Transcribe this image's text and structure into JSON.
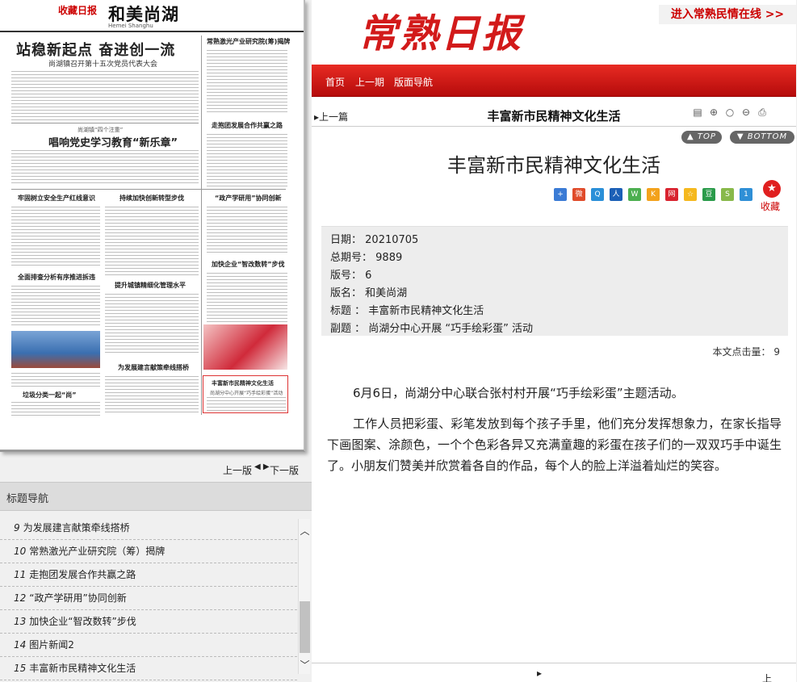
{
  "paper_preview": {
    "logo_text": "收藏日报",
    "page_name": "和美尚湖",
    "page_pinyin": "Hemei Shanghu",
    "headline": "站稳新起点 奋进创一流",
    "headline_sub": "尚湖镇召开第十五次党员代表大会",
    "kicker": "尚湖镇“四个注重”",
    "h_party": "唱响党史学习教育“新乐章”",
    "h_laser": "常熟激光产业研究院(筹)揭牌",
    "h_group": "走抱团发展合作共赢之路",
    "h_safety": "牢固树立安全生产红线意识",
    "h_transform": "持续加快创新转型步伐",
    "h_zcx": "“政产学研用”协同创新",
    "h_env": "全面排查分析有序推进拆违",
    "h_digital": "加快企业“智改数转”步伐",
    "h_urban": "提升城镇精细化管理水平",
    "h_bridge": "为发展建言献策牵线搭桥",
    "h_garbage": "垃圾分类一起“尚”",
    "h_culture": "丰富新市民精神文化生活",
    "h_culture_sub": "尚湖分中心开展“巧手绘彩蛋”活动"
  },
  "pager": {
    "prev": "上一版",
    "arrows": "◀ ▶",
    "next": "下一版"
  },
  "title_nav": {
    "header": "标题导航",
    "items": [
      {
        "num": "9",
        "label": "为发展建言献策牵线搭桥"
      },
      {
        "num": "10",
        "label": "常熟激光产业研究院（筹）揭牌"
      },
      {
        "num": "11",
        "label": "走抱团发展合作共赢之路"
      },
      {
        "num": "12",
        "label": "“政产学研用”协同创新"
      },
      {
        "num": "13",
        "label": "加快企业“智改数转”步伐"
      },
      {
        "num": "14",
        "label": "图片新闻2"
      },
      {
        "num": "15",
        "label": "丰富新市民精神文化生活"
      }
    ]
  },
  "masthead": {
    "brand": "常熟日报",
    "promo": "进入常熟民情在线 >>"
  },
  "nav": {
    "home": "首页",
    "prev_issue": "上一期",
    "page_nav": "版面导航"
  },
  "article_bar": {
    "prev": "上一篇",
    "title": "丰富新市民精神文化生活"
  },
  "jump": {
    "top": "TOP",
    "bottom": "BOTTOM"
  },
  "article": {
    "title": "丰富新市民精神文化生活",
    "favorite_label": "收藏",
    "meta": {
      "date_label": "日期",
      "date": "20210705",
      "total_label": "总期号",
      "total": "9889",
      "page_no_label": "版号",
      "page_no": "6",
      "page_name_label": "版名",
      "page_name": "和美尚湖",
      "title_label": "标题",
      "title": "丰富新市民精神文化生活",
      "subtitle_label": "副题",
      "subtitle": "尚湖分中心开展 “巧手绘彩蛋” 活动"
    },
    "clicks_label": "本文点击量：",
    "clicks": "9",
    "paragraphs": [
      "6月6日，尚湖分中心联合张村村开展“巧手绘彩蛋”主题活动。",
      "工作人员把彩蛋、彩笔发放到每个孩子手里，他们充分发挥想象力，在家长指导下画图案、涂颜色，一个个色彩各异又充满童趣的彩蛋在孩子们的一双双巧手中诞生了。小朋友们赞美并欣赏着各自的作品，每个人的脸上洋溢着灿烂的笑容。"
    ]
  },
  "bottom_bar": {
    "prev": "上一篇"
  },
  "colors": {
    "brand_red": "#d21a1a",
    "nav_red": "#e82b23"
  }
}
